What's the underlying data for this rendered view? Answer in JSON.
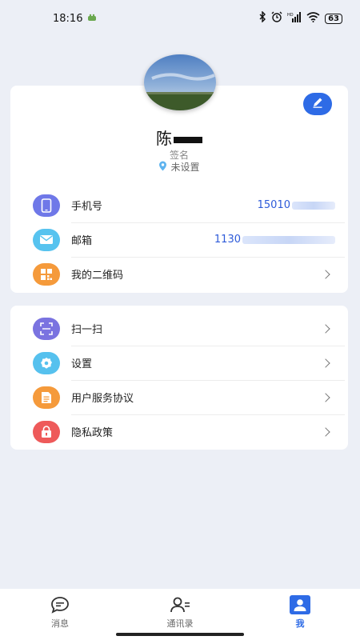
{
  "status_bar": {
    "time": "18:16",
    "battery": "63"
  },
  "profile": {
    "name": "陈",
    "signature": "签名",
    "location": "未设置"
  },
  "info_rows": [
    {
      "label": "手机号",
      "value": "15010"
    },
    {
      "label": "邮箱",
      "value": "1130"
    },
    {
      "label": "我的二维码"
    }
  ],
  "settings_rows": [
    {
      "label": "扫一扫"
    },
    {
      "label": "设置"
    },
    {
      "label": "用户服务协议"
    },
    {
      "label": "隐私政策"
    }
  ],
  "bottom_nav": {
    "items": [
      {
        "label": "消息"
      },
      {
        "label": "通讯录"
      },
      {
        "label": "我"
      }
    ]
  },
  "colors": {
    "accent": "#2e6be6",
    "phone_icon": "#6f78e8",
    "mail_icon": "#57c3ef",
    "qr_icon": "#f59a3b",
    "scan_icon": "#7a73e0",
    "settings_icon": "#56c1ee",
    "agreement_icon": "#f59a3b",
    "privacy_icon": "#ee5a5a"
  }
}
